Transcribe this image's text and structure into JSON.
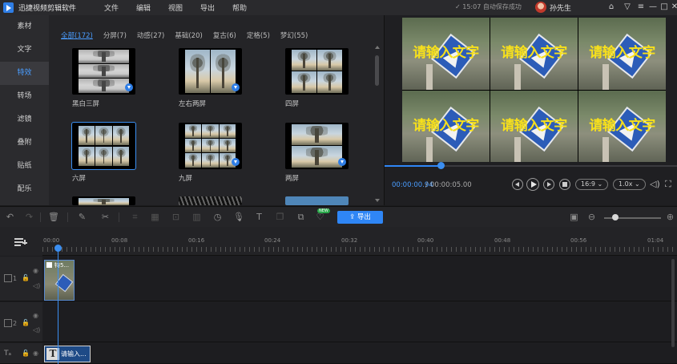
{
  "app": {
    "title": "迅捷视频剪辑软件",
    "menu": [
      "文件",
      "编辑",
      "视图",
      "导出",
      "帮助"
    ],
    "save_status": "15:07 自动保存成功",
    "user_name": "孙先生",
    "window_buttons": [
      "home-icon",
      "tshirt-icon",
      "menu-icon",
      "minimize-icon",
      "maximize-icon",
      "close-icon"
    ]
  },
  "sidebar": {
    "items": [
      {
        "label": "素材"
      },
      {
        "label": "文字"
      },
      {
        "label": "特效",
        "active": true
      },
      {
        "label": "转场"
      },
      {
        "label": "滤镜"
      },
      {
        "label": "叠附"
      },
      {
        "label": "贴纸"
      },
      {
        "label": "配乐"
      }
    ]
  },
  "effects": {
    "categories": [
      {
        "label": "全部(172)",
        "active": true
      },
      {
        "label": "分屏(7)"
      },
      {
        "label": "动感(27)"
      },
      {
        "label": "基础(20)"
      },
      {
        "label": "复古(6)"
      },
      {
        "label": "定格(5)"
      },
      {
        "label": "梦幻(55)"
      }
    ],
    "items": [
      {
        "label": "黑白三屏",
        "downloadable": true
      },
      {
        "label": "左右两屏",
        "downloadable": true
      },
      {
        "label": "四屏",
        "downloadable": false
      },
      {
        "label": "六屏",
        "downloadable": false,
        "selected": true
      },
      {
        "label": "九屏",
        "downloadable": true
      },
      {
        "label": "两屏",
        "downloadable": true
      }
    ]
  },
  "preview": {
    "overlay_text": "请输入文字",
    "current_time": "00:00:00.94",
    "separator": "/",
    "total_time": "00:00:05.00",
    "progress": 0.19,
    "aspect_ratio": "16:9",
    "speed": "1.0x",
    "accent": "#2f86f6",
    "overlay_color": "#f7e01c"
  },
  "toolbar": {
    "export_label": "导出",
    "new_badge": "NEW",
    "zoom_level": 0.2
  },
  "timeline": {
    "ruler_labels": [
      "00:00",
      "00:08",
      "00:16",
      "00:24",
      "00:32",
      "00:40",
      "00:48",
      "00:56",
      "01:04"
    ],
    "tracks": [
      {
        "number": "1"
      },
      {
        "number": "2"
      }
    ],
    "video_clip_label": "特5...",
    "text_clip_label": "请输入..."
  }
}
